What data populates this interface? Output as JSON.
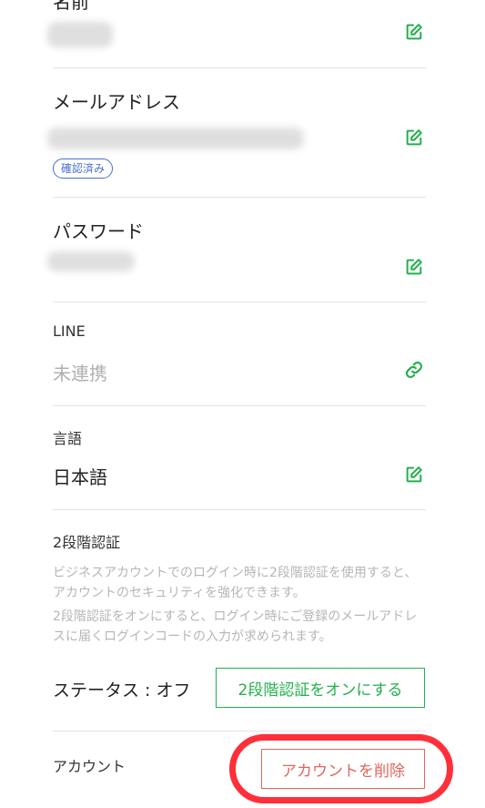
{
  "colors": {
    "accent_green": "#22b14c",
    "danger_red": "#e0665b",
    "badge_blue": "#4a6ed0",
    "highlight_red": "#ff2f3a"
  },
  "name_section": {
    "label": "名前",
    "edit_icon": "edit-icon"
  },
  "email_section": {
    "label": "メールアドレス",
    "badge": "確認済み",
    "edit_icon": "edit-icon"
  },
  "password_section": {
    "label": "パスワード",
    "edit_icon": "edit-icon"
  },
  "line_section": {
    "label": "LINE",
    "value": "未連携",
    "link_icon": "link-icon"
  },
  "language_section": {
    "label": "言語",
    "value": "日本語",
    "edit_icon": "edit-icon"
  },
  "two_factor": {
    "label": "2段階認証",
    "desc1": "ビジネスアカウントでのログイン時に2段階認証を使用すると、アカウントのセキュリティを強化できます。",
    "desc2": "2段階認証をオンにすると、ログイン時にご登録のメールアドレスに届くログインコードの入力が求められます。",
    "status": "ステータス : オフ",
    "enable_button": "2段階認証をオンにする"
  },
  "account_section": {
    "label": "アカウント",
    "delete_button": "アカウントを削除"
  }
}
